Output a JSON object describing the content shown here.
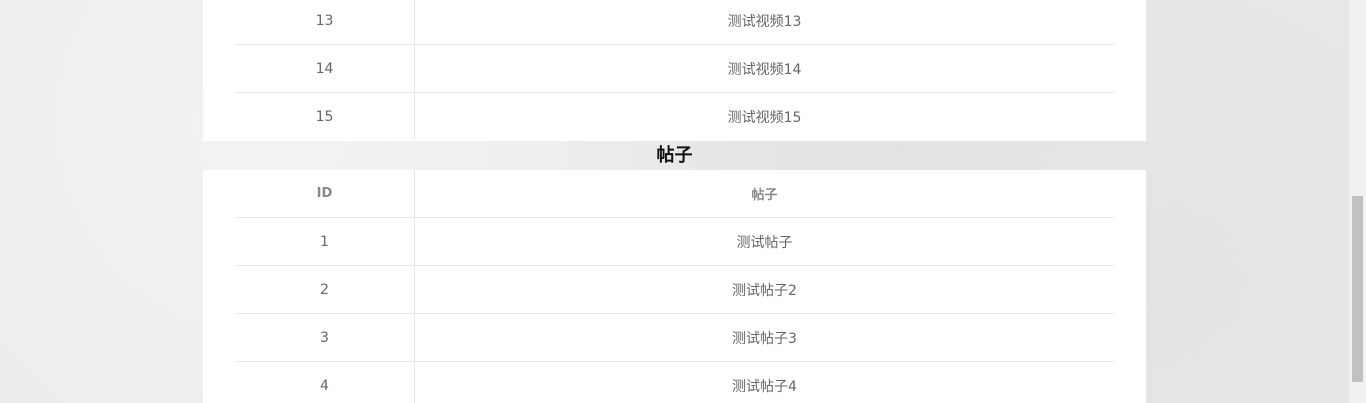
{
  "videos_table": {
    "rows": [
      {
        "id": "13",
        "name": "测试视频13"
      },
      {
        "id": "14",
        "name": "测试视频14"
      },
      {
        "id": "15",
        "name": "测试视频15"
      }
    ]
  },
  "posts_section": {
    "title": "帖子",
    "headers": {
      "id": "ID",
      "name": "帖子"
    },
    "rows": [
      {
        "id": "1",
        "name": "测试帖子"
      },
      {
        "id": "2",
        "name": "测试帖子2"
      },
      {
        "id": "3",
        "name": "测试帖子3"
      },
      {
        "id": "4",
        "name": "测试帖子4"
      }
    ]
  }
}
